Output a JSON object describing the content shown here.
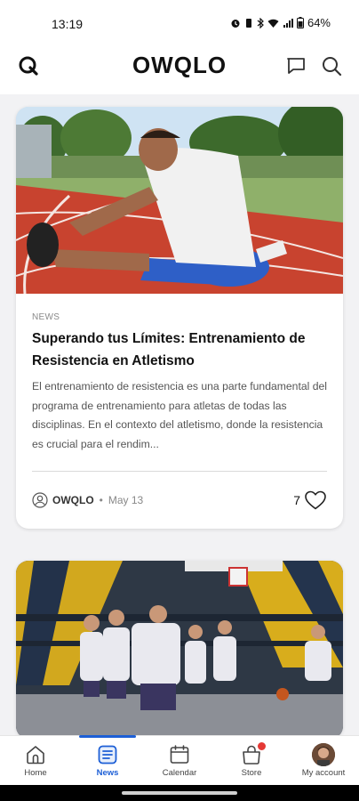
{
  "status": {
    "time": "13:19",
    "battery": "64%"
  },
  "header": {
    "brand": "OWQLO",
    "icons": [
      "logo-mark-icon",
      "chat-icon",
      "search-icon"
    ]
  },
  "feed": [
    {
      "category": "NEWS",
      "title": "Superando tus Límites: Entrenamiento de Resistencia en Atletismo",
      "excerpt": "El entrenamiento de resistencia es una parte fundamental del programa de entrenamiento para atletas de todas las disciplinas. En el contexto del atletismo, donde la resistencia es crucial para el rendim...",
      "author": "OWQLO",
      "separator": "•",
      "date": "May 13",
      "likes": "7"
    },
    {
      "image": "basketball-players-photo"
    }
  ],
  "bottom_nav": {
    "items": [
      {
        "label": "Home",
        "icon": "home-icon"
      },
      {
        "label": "News",
        "icon": "news-icon",
        "active": true
      },
      {
        "label": "Calendar",
        "icon": "calendar-icon"
      },
      {
        "label": "Store",
        "icon": "store-icon"
      },
      {
        "label": "My account",
        "icon": "avatar"
      }
    ]
  },
  "colors": {
    "accent": "#1d5fd6",
    "badge": "#e53935",
    "track": "#c8432f"
  }
}
